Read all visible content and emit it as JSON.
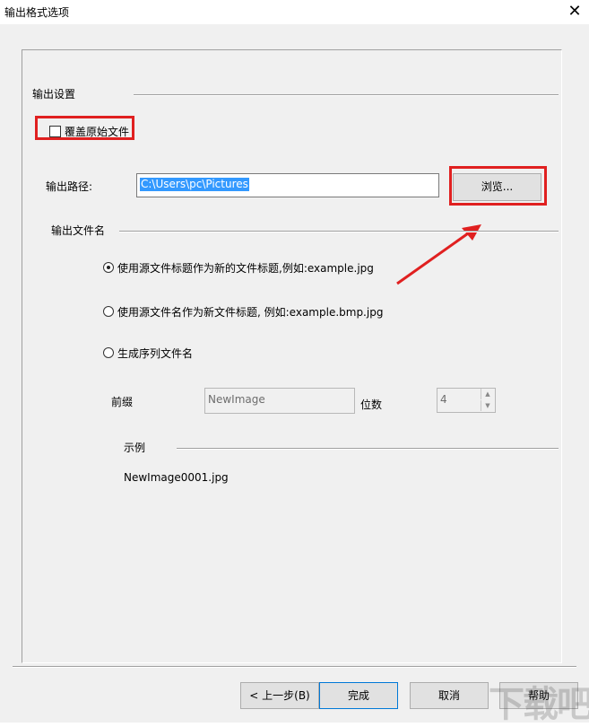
{
  "window": {
    "title": "输出格式选项"
  },
  "output_settings": {
    "section_label": "输出设置",
    "overwrite_label": "覆盖原始文件",
    "overwrite_checked": false,
    "path_label": "输出路径:",
    "path_value": "C:\\Users\\pc\\Pictures",
    "browse_label": "浏览..."
  },
  "filename": {
    "section_label": "输出文件名",
    "options": [
      {
        "label": "使用源文件标题作为新的文件标题,例如:example.jpg",
        "checked": true
      },
      {
        "label": "使用源文件名作为新文件标题, 例如:example.bmp.jpg",
        "checked": false
      },
      {
        "label": "生成序列文件名",
        "checked": false
      }
    ],
    "prefix_label": "前缀",
    "prefix_value": "NewImage",
    "digits_label": "位数",
    "digits_value": "4",
    "example_label": "示例",
    "example_value": "NewImage0001.jpg"
  },
  "buttons": {
    "back": "< 上一步(B)",
    "finish": "完成",
    "cancel": "取消",
    "help": "帮助"
  },
  "watermark": {
    "text": "下载吧"
  },
  "colors": {
    "highlight": "#e02020",
    "selection": "#3399ff",
    "dialog_bg": "#f0f0f0"
  }
}
